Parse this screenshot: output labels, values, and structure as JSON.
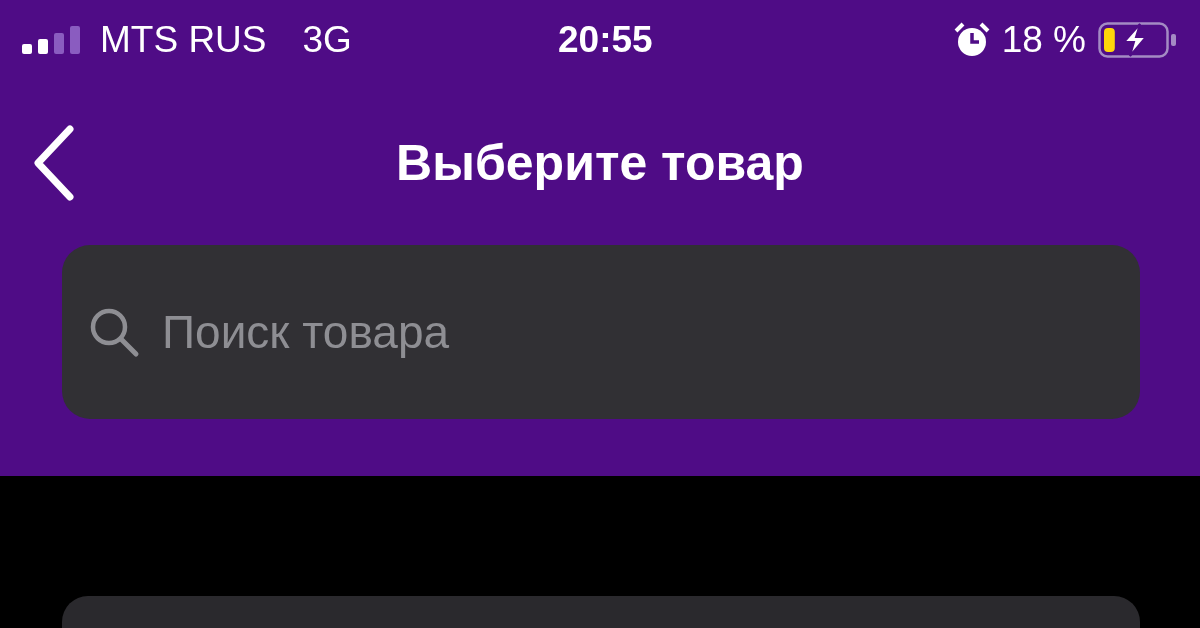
{
  "status_bar": {
    "carrier": "MTS RUS",
    "network": "3G",
    "time": "20:55",
    "battery_percent": "18 %",
    "battery": {
      "level": 0.18,
      "charging": true
    }
  },
  "nav": {
    "title": "Выберите товар"
  },
  "search": {
    "placeholder": "Поиск товара"
  }
}
